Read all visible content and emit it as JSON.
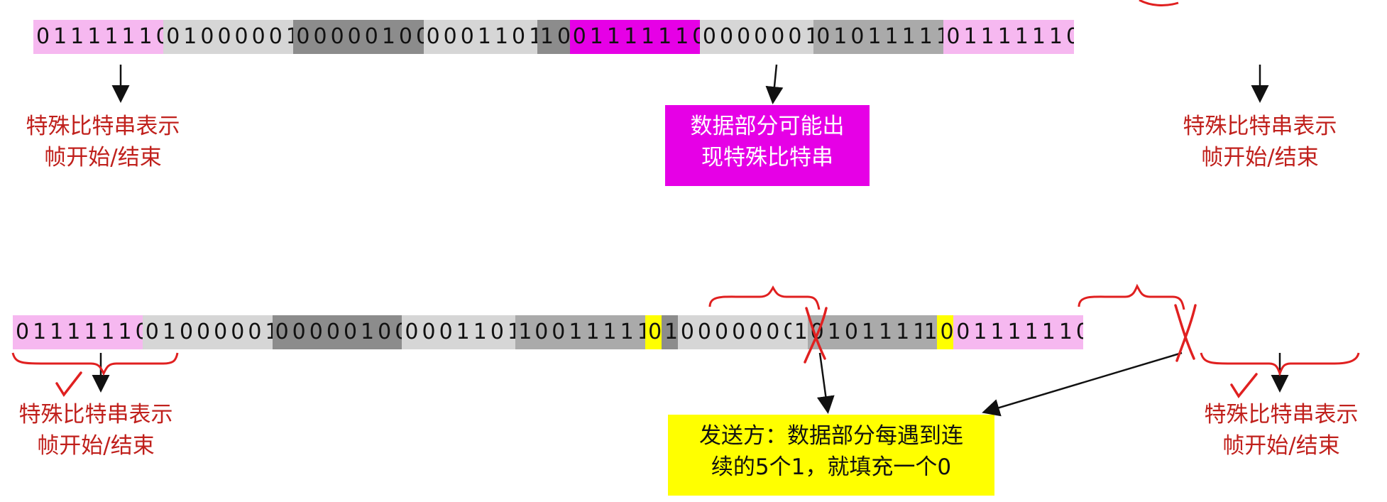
{
  "colors": {
    "flag": "#f6b8f0",
    "magenta": "#e600e6",
    "light_gray": "#d6d6d6",
    "mid_gray": "#aaaaaa",
    "dark_gray": "#8c8c8c",
    "yellow": "#ffff00",
    "label_red": "#c0201c",
    "ink_red": "#e02020",
    "arrow": "#111111"
  },
  "row1": {
    "segments": [
      {
        "bits": "01111110",
        "role": "flag"
      },
      {
        "bits": "01000001",
        "role": "light_gray"
      },
      {
        "bits": "00000100",
        "role": "dark_gray"
      },
      {
        "bits": "0001101",
        "role": "light_gray"
      },
      {
        "bits": "10",
        "role": "dark_gray"
      },
      {
        "bits": "01111110",
        "role": "magenta"
      },
      {
        "bits": "0000001",
        "role": "light_gray"
      },
      {
        "bits": "01011111",
        "role": "mid_gray"
      },
      {
        "bits": "01111110",
        "role": "flag"
      }
    ],
    "label_left": [
      "特殊比特串表示",
      "帧开始/结束"
    ],
    "label_right": [
      "特殊比特串表示",
      "帧开始/结束"
    ],
    "label_middle": [
      "数据部分可能出",
      "现特殊比特串"
    ]
  },
  "row2": {
    "segments": [
      {
        "bits": "01111110",
        "role": "flag"
      },
      {
        "bits": "01000001",
        "role": "light_gray"
      },
      {
        "bits": "00000100",
        "role": "dark_gray"
      },
      {
        "bits": "0001101",
        "role": "light_gray"
      },
      {
        "bits": "1",
        "role": "mid_gray"
      },
      {
        "bits": "0011111",
        "role": "mid_gray"
      },
      {
        "bits": "0",
        "role": "yellow"
      },
      {
        "bits": "1",
        "role": "dark_gray"
      },
      {
        "bits": "0000000",
        "role": "light_gray"
      },
      {
        "bits": "1",
        "role": "light_gray"
      },
      {
        "bits": "0101111",
        "role": "mid_gray"
      },
      {
        "bits": "1",
        "role": "mid_gray"
      },
      {
        "bits": "0",
        "role": "yellow"
      },
      {
        "bits": "01111110",
        "role": "flag"
      }
    ],
    "label_left": [
      "特殊比特串表示",
      "帧开始/结束"
    ],
    "label_right": [
      "特殊比特串表示",
      "帧开始/结束"
    ],
    "callout": [
      "发送方：数据部分每遇到连",
      "续的5个1，就填充一个0"
    ]
  }
}
